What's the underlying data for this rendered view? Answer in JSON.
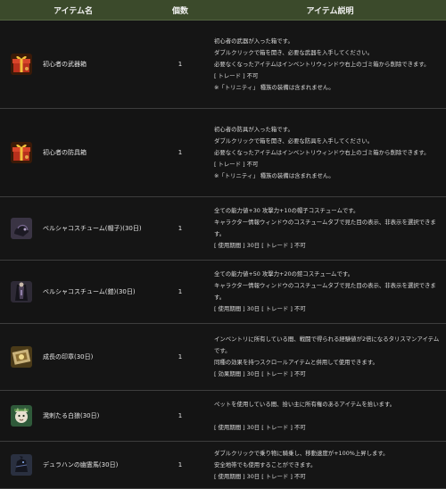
{
  "header": {
    "col_name": "アイテム名",
    "col_qty": "個数",
    "col_desc": "アイテム説明"
  },
  "rows": [
    {
      "icon": "red-gift-box-icon",
      "name": "初心者の武器箱",
      "qty": "1",
      "desc": [
        "初心者の武器が入った箱です。",
        "ダブルクリックで箱を開き、必要な武器を入手してください。",
        "必要なくなったアイテムはインベントリウィンドウ右上のゴミ箱から削除できます。",
        "[ トレード ] 不可",
        "※「トリニティ」 種族の装備は含まれません。"
      ]
    },
    {
      "icon": "red-gift-box-icon",
      "name": "初心者の防具箱",
      "qty": "1",
      "desc": [
        "初心者の防具が入った箱です。",
        "ダブルクリックで箱を開き、必要な防具を入手してください。",
        "必要なくなったアイテムはインベントリウィンドウ右上のゴミ箱から削除できます。",
        "[ トレード ] 不可",
        "※「トリニティ」 種族の装備は含まれません。"
      ]
    },
    {
      "icon": "dark-hat-icon",
      "name": "ベルシャコスチューム(帽子)(30日)",
      "qty": "1",
      "desc": [
        "全ての能力値+30 攻撃力+10の帽子コスチュームです。",
        "キャラクター情報ウィンドウのコスチュームタブで見た目の表示、非表示を選択できます。",
        "[ 使用期間 ] 30日 [ トレード ] 不可"
      ]
    },
    {
      "icon": "dark-costume-icon",
      "name": "ベルシャコスチューム(鎧)(30日)",
      "qty": "1",
      "desc": [
        "全ての能力値+50 攻撃力+20の鎧コスチュームです。",
        "キャラクター情報ウィンドウのコスチュームタブで見た目の表示、非表示を選択できます。",
        "[ 使用期間 ] 30日 [ トレード ] 不可"
      ]
    },
    {
      "icon": "golden-seal-icon",
      "name": "成長の印章(30日)",
      "qty": "1",
      "desc": [
        "インベントリに所有している間、戦闘で得られる経験値が2倍になるタリスマンアイテムです。",
        "同種の効果を持つスクロールアイテムと併用して使用できます。",
        "[ 効果期間 ] 30日 [ トレード ] 不可"
      ]
    },
    {
      "icon": "green-pet-icon",
      "name": "溌剌たる白狼(30日)",
      "qty": "1",
      "desc": [
        "ペットを使用している間、拾い主に所有権のあるアイテムを拾います。",
        "",
        "[ 使用期間 ] 30日 [ トレード ] 不可"
      ]
    },
    {
      "icon": "dark-horse-icon",
      "name": "デュラハンの幽霊馬(30日)",
      "qty": "1",
      "desc": [
        "ダブルクリックで乗り物に騎乗し、移動速度が+100%上昇します。",
        "安全地帯でも使用することができます。",
        "[ 使用期間 ] 30日 [ トレード ] 不可"
      ]
    }
  ]
}
